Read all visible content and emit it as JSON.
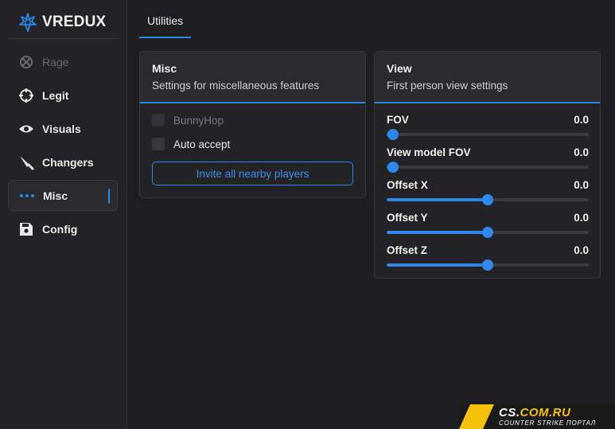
{
  "brand": {
    "name": "VREDUX"
  },
  "sidebar": {
    "items": [
      {
        "label": "Rage",
        "icon": "crosshair-x-icon",
        "disabled": true
      },
      {
        "label": "Legit",
        "icon": "crosshair-icon"
      },
      {
        "label": "Visuals",
        "icon": "eye-icon"
      },
      {
        "label": "Changers",
        "icon": "knife-icon"
      },
      {
        "label": "Misc",
        "icon": "more-dots-icon",
        "active": true
      },
      {
        "label": "Config",
        "icon": "save-icon"
      }
    ]
  },
  "tabs": [
    {
      "label": "Utilities",
      "active": true
    }
  ],
  "misc": {
    "title": "Misc",
    "subtitle": "Settings for miscellaneous features",
    "options": [
      {
        "label": "BunnyHop",
        "checked": false,
        "disabled": true
      },
      {
        "label": "Auto accept",
        "checked": false
      }
    ],
    "invite_button": "Invite all nearby players"
  },
  "view": {
    "title": "View",
    "subtitle": "First person view settings",
    "sliders": [
      {
        "label": "FOV",
        "value": "0.0",
        "position": 0.03
      },
      {
        "label": "View model FOV",
        "value": "0.0",
        "position": 0.03
      },
      {
        "label": "Offset X",
        "value": "0.0",
        "position": 0.5
      },
      {
        "label": "Offset Y",
        "value": "0.0",
        "position": 0.5
      },
      {
        "label": "Offset Z",
        "value": "0.0",
        "position": 0.5
      }
    ]
  },
  "watermark": {
    "site": "CS.COM.RU",
    "site_prefix": "CS.",
    "site_suffix": "COM.RU",
    "tagline": "COUNTER STRIKE ПОРТАЛ"
  },
  "colors": {
    "accent": "#2f86eb",
    "watermark_yellow": "#f4c20d"
  }
}
